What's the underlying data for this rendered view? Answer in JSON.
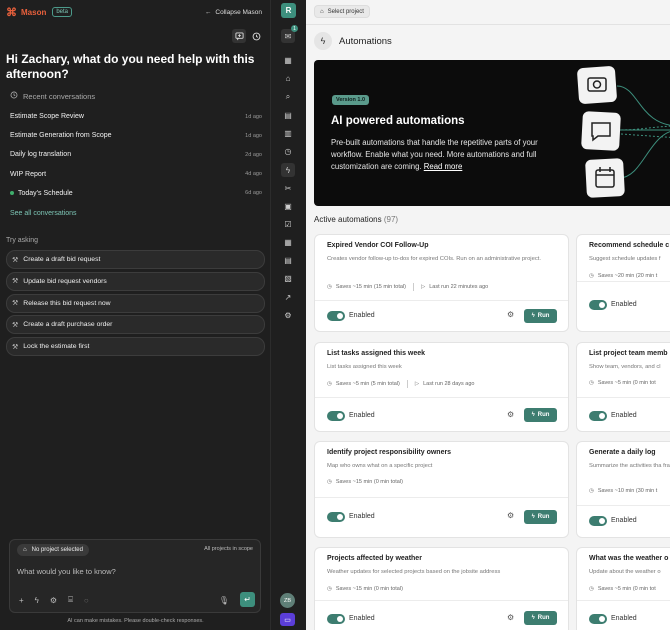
{
  "chat": {
    "brand": "Mason",
    "beta": "beta",
    "collapse_label": "Collapse Mason",
    "greeting": "Hi Zachary, what do you need help with this afternoon?",
    "recent_title": "Recent conversations",
    "conversations": [
      {
        "title": "Estimate Scope Review",
        "date": "1d ago"
      },
      {
        "title": "Estimate Generation from Scope",
        "date": "1d ago"
      },
      {
        "title": "Daily log translation",
        "date": "2d ago"
      },
      {
        "title": "WIP Report",
        "date": "4d ago"
      },
      {
        "title": "Today's Schedule",
        "date": "6d ago"
      }
    ],
    "see_all": "See all conversations",
    "try_asking": "Try asking",
    "suggestions": [
      "Create a draft bid request",
      "Update bid request vendors",
      "Release this bid request now",
      "Create a draft purchase order",
      "Lock the estimate first"
    ],
    "composer": {
      "project_chip": "No project selected",
      "scope": "All projects in scope",
      "placeholder": "What would you like to know?"
    },
    "disclaimer": "AI can make mistakes. Please double-check responses."
  },
  "rail": {
    "logo": "R",
    "badge": "1",
    "avatar": "ZB"
  },
  "main": {
    "select_project": "Select project",
    "title": "Automations",
    "hero": {
      "version": "Version 1.0",
      "title": "AI powered automations",
      "body": "Pre-built automations that handle the repetitive parts of your workflow. Enable what you need. More automations and full customization are coming.",
      "link": "Read more"
    },
    "active_label": "Active automations",
    "active_count": "(97)",
    "enabled_label": "Enabled",
    "run_label": "Run",
    "cards": [
      {
        "title": "Expired Vendor COI Follow-Up",
        "desc": "Creates vendor follow-up to-dos for expired COIs. Run on an administrative project.",
        "saves": "Saves ~15 min (15 min total)",
        "last_run": "Last run 22 minutes ago"
      },
      {
        "title": "Recommend schedule c",
        "desc": "Suggest schedule updates f",
        "saves": "Saves ~20 min (20 min t"
      },
      {
        "title": "List tasks assigned this week",
        "desc": "List tasks assigned this week",
        "saves": "Saves ~5 min (5 min total)",
        "last_run": "Last run 28 days ago"
      },
      {
        "title": "List project team memb",
        "desc": "Show team, vendors, and cl",
        "saves": "Saves ~5 min (0 min tot"
      },
      {
        "title": "Identify project responsibility owners",
        "desc": "Map who owns what on a specific project",
        "saves": "Saves ~15 min (0 min total)"
      },
      {
        "title": "Generate a daily log",
        "desc": "Summarize the activities tha frame",
        "saves": "Saves ~10 min (30 min t"
      },
      {
        "title": "Projects affected by weather",
        "desc": "Weather updates for selected projects based on the jobsite address",
        "saves": "Saves ~15 min (0 min total)"
      },
      {
        "title": "What was the weather o",
        "desc": "Update about the weather o",
        "saves": "Saves ~5 min (0 min tot"
      }
    ]
  }
}
